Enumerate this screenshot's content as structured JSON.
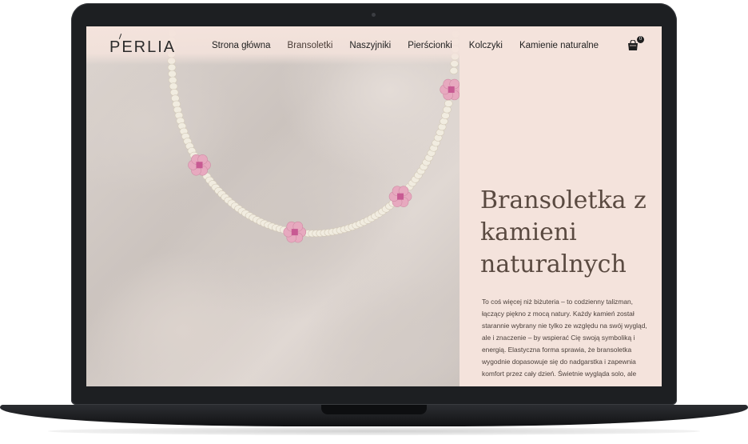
{
  "brand": {
    "logo_text": "PERLIA"
  },
  "nav": {
    "items": [
      {
        "label": "Strona główna"
      },
      {
        "label": "Bransoletki"
      },
      {
        "label": "Naszyjniki"
      },
      {
        "label": "Pierścionki"
      },
      {
        "label": "Kolczyki"
      },
      {
        "label": "Kamienie naturalne"
      }
    ]
  },
  "cart": {
    "icon": "shopping-bag-icon",
    "count": "0"
  },
  "hero": {
    "image": "beaded-bracelet-with-pink-flowers-on-marble"
  },
  "product": {
    "title": "Bransoletka z kamieni naturalnych",
    "description": "To coś więcej niż biżuteria – to codzienny talizman, łączący piękno z mocą natury. Każdy kamień został starannie wybrany nie tylko ze względu na swój wygląd, ale i znaczenie – by wspierać Cię swoją symboliką i energią. Elastyczna forma sprawia, że bransoletka wygodnie dopasowuje się do nadgarstka i zapewnia komfort przez cały dzień. Świetnie wygląda solo, ale"
  },
  "colors": {
    "background": "#f4e3dc",
    "title": "#5a4a41",
    "device": "#1d1f22"
  }
}
